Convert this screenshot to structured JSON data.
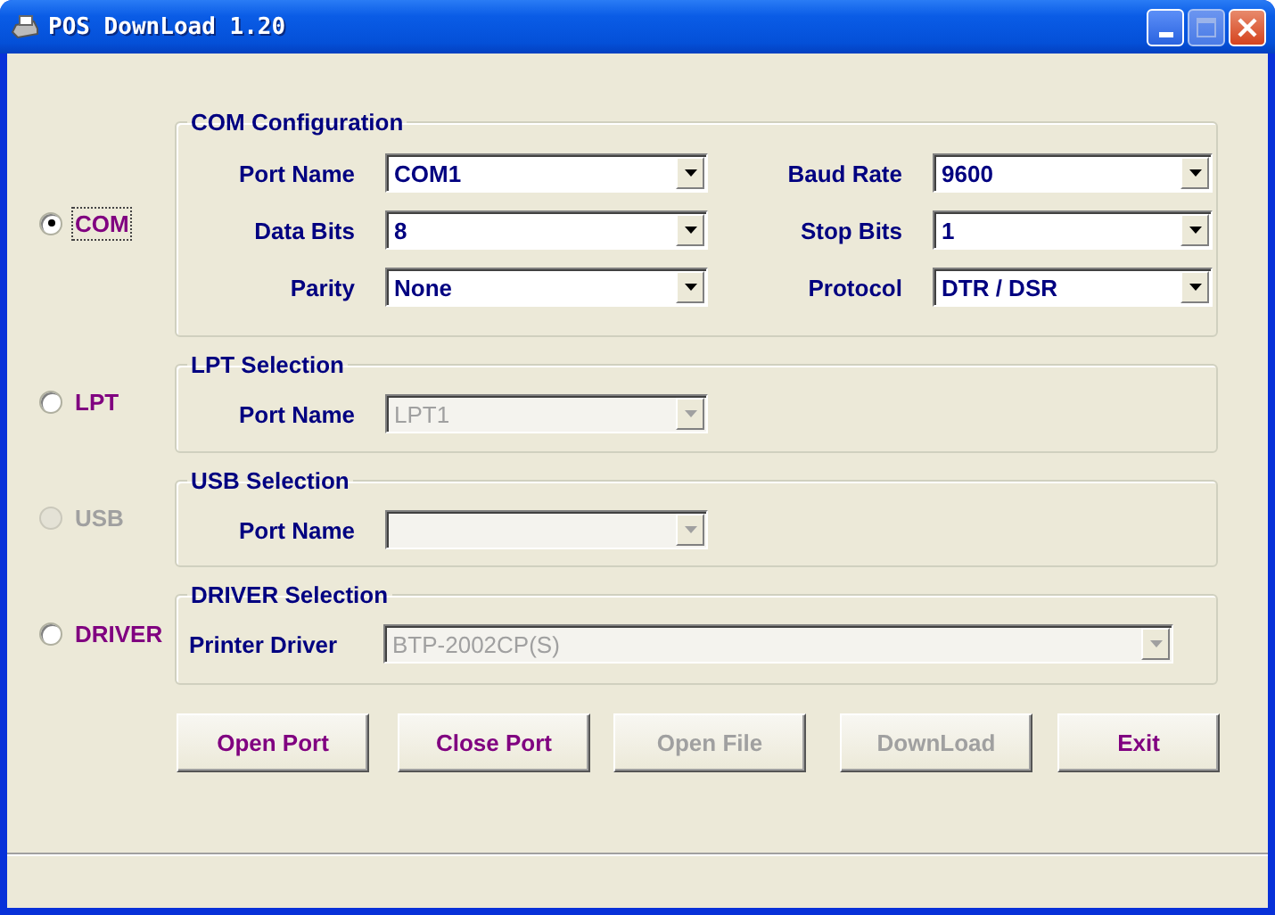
{
  "window": {
    "title": "POS DownLoad 1.20"
  },
  "sections": [
    {
      "radio": {
        "label": "COM",
        "selected": true,
        "disabled": false,
        "focused": true
      },
      "title": "COM Configuration",
      "kind": "grid",
      "fields": [
        {
          "label": "Port Name",
          "value": "COM1",
          "disabled": false
        },
        {
          "label": "Baud Rate",
          "value": "9600",
          "disabled": false
        },
        {
          "label": "Data Bits",
          "value": "8",
          "disabled": false
        },
        {
          "label": "Stop Bits",
          "value": "1",
          "disabled": false
        },
        {
          "label": "Parity",
          "value": "None",
          "disabled": false
        },
        {
          "label": "Protocol",
          "value": "DTR / DSR",
          "disabled": false
        }
      ]
    },
    {
      "radio": {
        "label": "LPT",
        "selected": false,
        "disabled": false,
        "focused": false
      },
      "title": "LPT Selection",
      "kind": "single",
      "fields": [
        {
          "label": "Port Name",
          "value": "LPT1",
          "disabled": true
        }
      ]
    },
    {
      "radio": {
        "label": "USB",
        "selected": false,
        "disabled": true,
        "focused": false
      },
      "title": "USB Selection",
      "kind": "single",
      "fields": [
        {
          "label": "Port Name",
          "disabled": true
        }
      ]
    },
    {
      "radio": {
        "label": "DRIVER",
        "selected": false,
        "disabled": false,
        "focused": false
      },
      "title": "DRIVER Selection",
      "kind": "wide",
      "fields": [
        {
          "label": "Printer Driver",
          "value": "BTP-2002CP(S)",
          "disabled": true
        }
      ]
    }
  ],
  "buttons": [
    {
      "label": "Open Port",
      "disabled": false
    },
    {
      "label": "Close Port",
      "disabled": false
    },
    {
      "label": "Open File",
      "disabled": true
    },
    {
      "label": "DownLoad",
      "disabled": true
    },
    {
      "label": "Exit",
      "disabled": false
    }
  ]
}
